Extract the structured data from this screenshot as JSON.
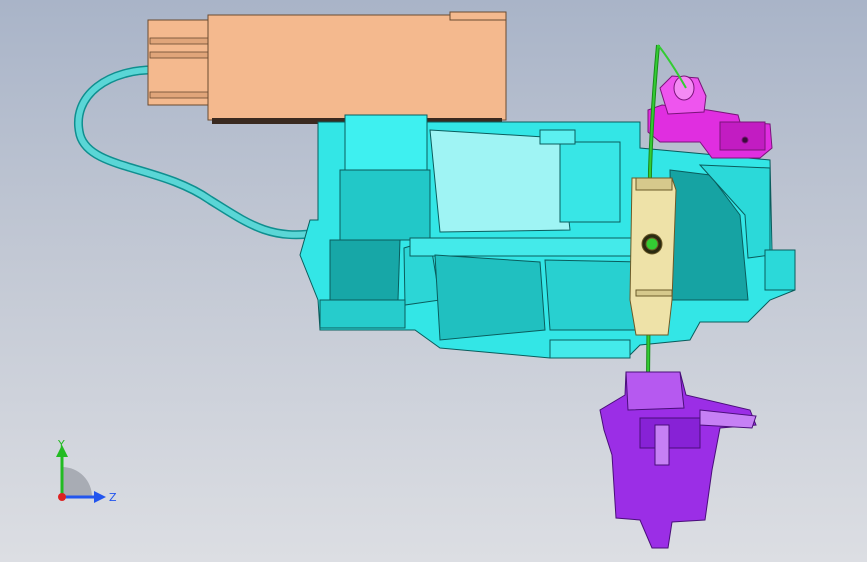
{
  "viewport": {
    "background_top": "#a9b4c8",
    "background_bottom": "#dcdee3"
  },
  "model": {
    "parts": [
      {
        "name": "connector-housing",
        "color": "#f4b98e"
      },
      {
        "name": "main-body",
        "color": "#33e6e6"
      },
      {
        "name": "top-bracket",
        "color": "#e02ee0"
      },
      {
        "name": "bottom-bracket",
        "color": "#9b2ee6"
      },
      {
        "name": "clamp-plate",
        "color": "#eee2a8"
      },
      {
        "name": "wire-harness",
        "color": "#5ad6d6"
      },
      {
        "name": "green-pin",
        "color": "#33cc33"
      }
    ]
  },
  "axis_triad": {
    "y_label": "Y",
    "z_label": "Z",
    "y_color": "#22bb22",
    "z_color": "#2255ee",
    "x_color": "#dd2222"
  }
}
